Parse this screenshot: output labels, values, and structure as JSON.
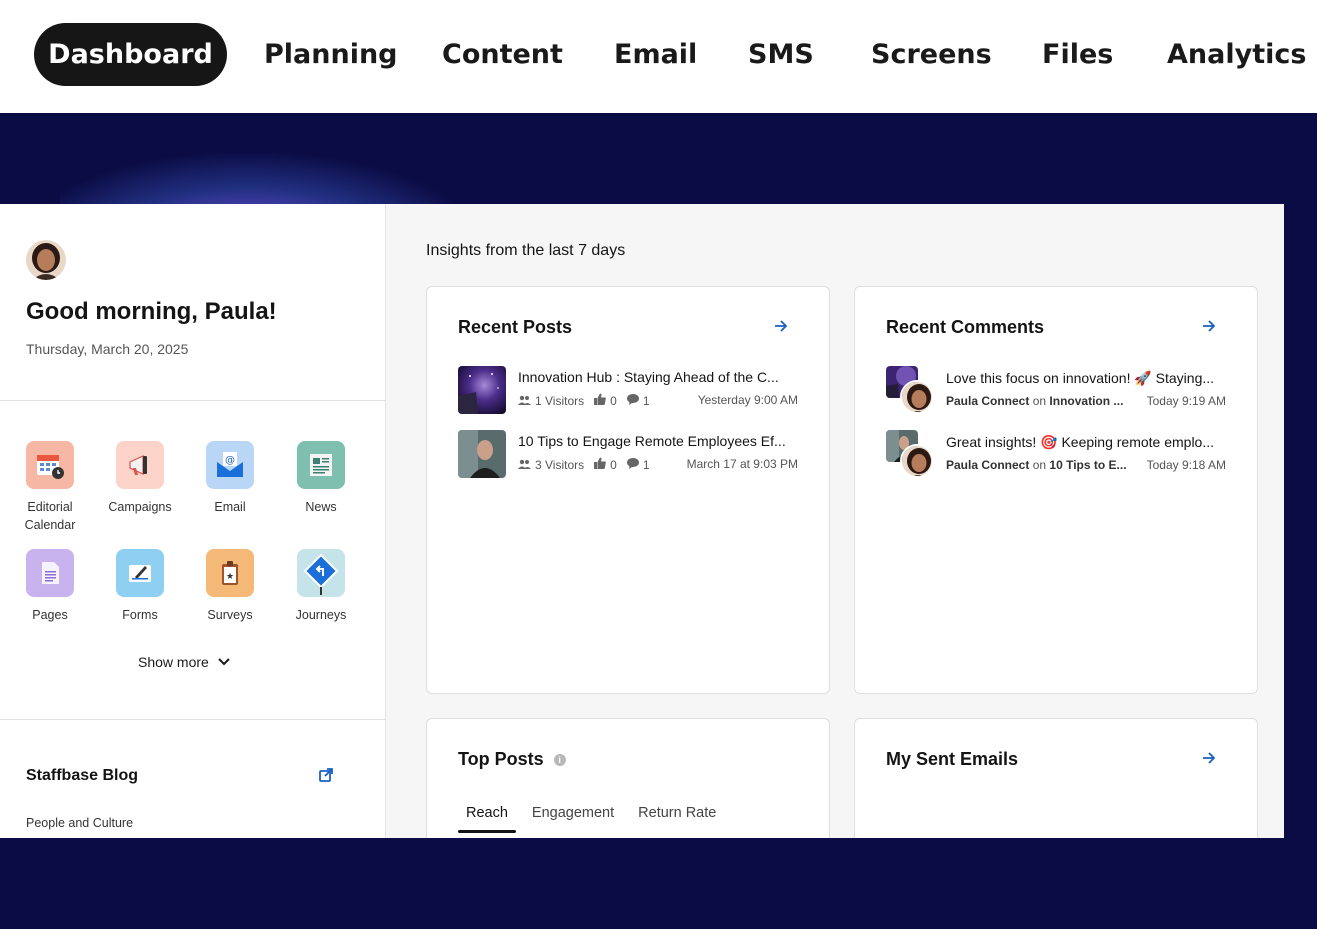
{
  "nav": {
    "tabs": [
      "Dashboard",
      "Planning",
      "Content",
      "Email",
      "SMS",
      "Screens",
      "Files",
      "Analytics"
    ],
    "active": "Dashboard"
  },
  "sidebar": {
    "greeting": "Good morning, Paula!",
    "date": "Thursday, March 20, 2025",
    "apps": [
      {
        "label": "Editorial\nCalendar",
        "icon": "editorial-calendar-icon",
        "color": "#f6b8a4"
      },
      {
        "label": "Campaigns",
        "icon": "megaphone-icon",
        "color": "#fbd3c8"
      },
      {
        "label": "Email",
        "icon": "envelope-icon",
        "color": "#b9d6f7"
      },
      {
        "label": "News",
        "icon": "newspaper-icon",
        "color": "#7fbfb0"
      },
      {
        "label": "Pages",
        "icon": "document-icon",
        "color": "#c9b3ee"
      },
      {
        "label": "Forms",
        "icon": "form-icon",
        "color": "#8fd0f2"
      },
      {
        "label": "Surveys",
        "icon": "clipboard-icon",
        "color": "#f4b877"
      },
      {
        "label": "Journeys",
        "icon": "journey-sign-icon",
        "color": "#c5e4ea"
      }
    ],
    "show_more": "Show more",
    "blog": {
      "title": "Staffbase Blog",
      "category": "People and Culture"
    }
  },
  "main": {
    "insights_heading": "Insights from the last 7 days",
    "recent_posts": {
      "title": "Recent Posts",
      "items": [
        {
          "title": "Innovation Hub : Staying Ahead of the C...",
          "visitors": "1 Visitors",
          "likes": "0",
          "comments": "1",
          "date": "Yesterday 9:00 AM"
        },
        {
          "title": "10 Tips to Engage Remote Employees Ef...",
          "visitors": "3 Visitors",
          "likes": "0",
          "comments": "1",
          "date": "March 17 at 9:03 PM"
        }
      ]
    },
    "recent_comments": {
      "title": "Recent Comments",
      "items": [
        {
          "text": "Love this focus on innovation! 🚀 Staying...",
          "author": "Paula Connect",
          "on": "on",
          "post": "Innovation ...",
          "date": "Today 9:19 AM"
        },
        {
          "text": "Great insights! 🎯 Keeping remote emplo...",
          "author": "Paula Connect",
          "on": "on",
          "post": "10 Tips to E...",
          "date": "Today 9:18 AM"
        }
      ]
    },
    "top_posts": {
      "title": "Top Posts",
      "tabs": [
        "Reach",
        "Engagement",
        "Return Rate"
      ],
      "active_tab": "Reach"
    },
    "sent_emails": {
      "title": "My Sent Emails"
    }
  },
  "colors": {
    "background": "#0b0c45",
    "accent": "#1a5fc4",
    "nav_active": "#161616"
  }
}
